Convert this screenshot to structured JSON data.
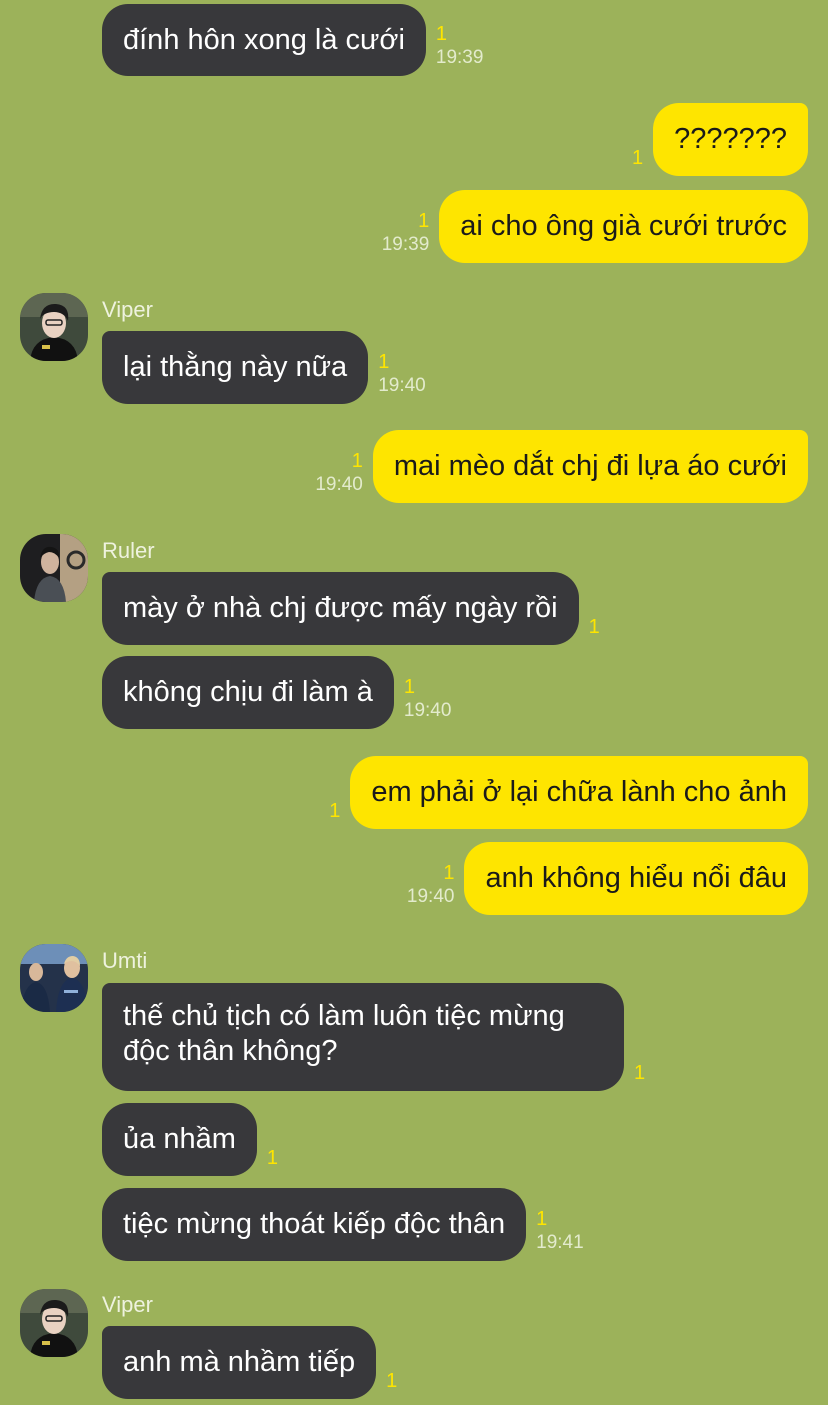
{
  "colors": {
    "background": "#9cb25a",
    "incoming_bubble": "#38383b",
    "outgoing_bubble": "#fee500",
    "unread_count": "#fee500"
  },
  "icons": {
    "avatar_viper": "viper-avatar-icon",
    "avatar_ruler": "ruler-avatar-icon",
    "avatar_umti": "umti-avatar-icon"
  },
  "senders": {
    "viper": "Viper",
    "ruler": "Ruler",
    "umti": "Umti"
  },
  "messages": [
    {
      "id": "m1",
      "direction": "in",
      "text": "đính hôn xong là cưới",
      "unread": "1",
      "time": "19:39"
    },
    {
      "id": "m2",
      "direction": "out",
      "text": "???????",
      "unread": "1",
      "time": ""
    },
    {
      "id": "m3",
      "direction": "out",
      "text": "ai cho ông già cưới trước",
      "unread": "1",
      "time": "19:39"
    },
    {
      "id": "m4",
      "direction": "in",
      "sender": "Viper",
      "text": "lại thằng này nữa",
      "unread": "1",
      "time": "19:40"
    },
    {
      "id": "m5",
      "direction": "out",
      "text": "mai mèo dắt chj đi lựa áo cưới",
      "unread": "1",
      "time": "19:40"
    },
    {
      "id": "m6",
      "direction": "in",
      "sender": "Ruler",
      "text": "mày ở nhà chj được mấy ngày rồi",
      "unread": "1",
      "time": ""
    },
    {
      "id": "m7",
      "direction": "in",
      "text": "không chịu đi làm à",
      "unread": "1",
      "time": "19:40"
    },
    {
      "id": "m8",
      "direction": "out",
      "text": "em phải ở lại chữa lành cho ảnh",
      "unread": "1",
      "time": ""
    },
    {
      "id": "m9",
      "direction": "out",
      "text": "anh không hiểu nổi đâu",
      "unread": "1",
      "time": "19:40"
    },
    {
      "id": "m10",
      "direction": "in",
      "sender": "Umti",
      "text": "thế chủ tịch có làm luôn tiệc mừng độc thân không?",
      "unread": "1",
      "time": ""
    },
    {
      "id": "m11",
      "direction": "in",
      "text": "ủa nhầm",
      "unread": "1",
      "time": ""
    },
    {
      "id": "m12",
      "direction": "in",
      "text": "tiệc mừng thoát kiếp độc thân",
      "unread": "1",
      "time": "19:41"
    },
    {
      "id": "m13",
      "direction": "in",
      "sender": "Viper",
      "text": "anh mà nhầm tiếp",
      "unread": "1",
      "time": ""
    }
  ]
}
